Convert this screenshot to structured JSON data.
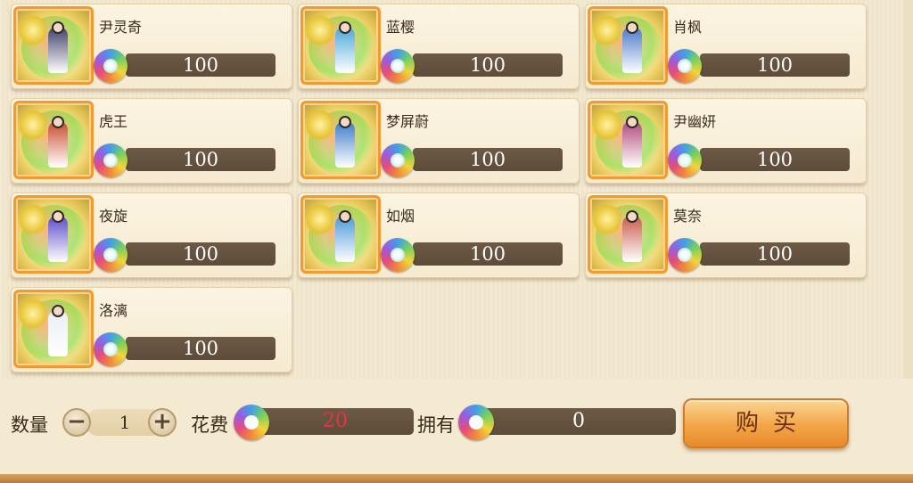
{
  "items": [
    {
      "name": "尹灵奇",
      "price": "100",
      "tint": "#3f3f6a"
    },
    {
      "name": "蓝樱",
      "price": "100",
      "tint": "#4aa6d8"
    },
    {
      "name": "肖枫",
      "price": "100",
      "tint": "#4a78c8"
    },
    {
      "name": "虎王",
      "price": "100",
      "tint": "#c84a2c"
    },
    {
      "name": "梦屏蔚",
      "price": "100",
      "tint": "#3a7ac8"
    },
    {
      "name": "尹幽妍",
      "price": "100",
      "tint": "#b04a78"
    },
    {
      "name": "夜旋",
      "price": "100",
      "tint": "#5a4ac8"
    },
    {
      "name": "如烟",
      "price": "100",
      "tint": "#4a98d8"
    },
    {
      "name": "莫奈",
      "price": "100",
      "tint": "#c85a4a"
    },
    {
      "name": "洛漓",
      "price": "100",
      "tint": "#e8eef6"
    }
  ],
  "purchase": {
    "quantity_label": "数量",
    "quantity": "1",
    "minus_symbol": "−",
    "plus_symbol": "+",
    "cost_label": "花费",
    "cost": "20",
    "owned_label": "拥有",
    "owned": "0",
    "buy_label": "购买"
  },
  "colors": {
    "accent_orange": "#f19a31",
    "price_bar": "#5d4c3a",
    "cost_text": "#e8324a"
  },
  "icons": {
    "currency": "rainbow-jade-coin-icon"
  }
}
